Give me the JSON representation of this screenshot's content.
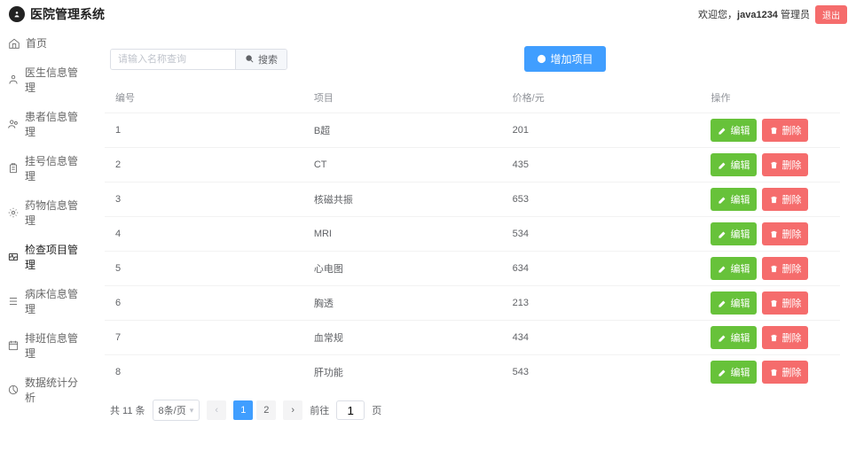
{
  "header": {
    "title": "医院管理系统",
    "welcome_prefix": "欢迎您，",
    "username": "java1234",
    "role": "管理员",
    "logout_label": "退出"
  },
  "sidebar": {
    "items": [
      {
        "label": "首页"
      },
      {
        "label": "医生信息管理"
      },
      {
        "label": "患者信息管理"
      },
      {
        "label": "挂号信息管理"
      },
      {
        "label": "药物信息管理"
      },
      {
        "label": "检查项目管理"
      },
      {
        "label": "病床信息管理"
      },
      {
        "label": "排班信息管理"
      },
      {
        "label": "数据统计分析"
      }
    ]
  },
  "toolbar": {
    "search_placeholder": "请输入名称查询",
    "search_label": "搜索",
    "add_label": "增加项目"
  },
  "table": {
    "headers": {
      "id": "编号",
      "project": "项目",
      "price": "价格/元",
      "ops": "操作"
    },
    "rows": [
      {
        "id": "1",
        "project": "B超",
        "price": "201"
      },
      {
        "id": "2",
        "project": "CT",
        "price": "435"
      },
      {
        "id": "3",
        "project": "核磁共振",
        "price": "653"
      },
      {
        "id": "4",
        "project": "MRI",
        "price": "534"
      },
      {
        "id": "5",
        "project": "心电图",
        "price": "634"
      },
      {
        "id": "6",
        "project": "胸透",
        "price": "213"
      },
      {
        "id": "7",
        "project": "血常规",
        "price": "434"
      },
      {
        "id": "8",
        "project": "肝功能",
        "price": "543"
      }
    ],
    "edit_label": "编辑",
    "delete_label": "删除"
  },
  "pagination": {
    "total_label": "共 11 条",
    "page_size_label": "8条/页",
    "pages": [
      "1",
      "2"
    ],
    "current": 1,
    "jump_prefix": "前往",
    "jump_value": "1",
    "jump_suffix": "页"
  }
}
